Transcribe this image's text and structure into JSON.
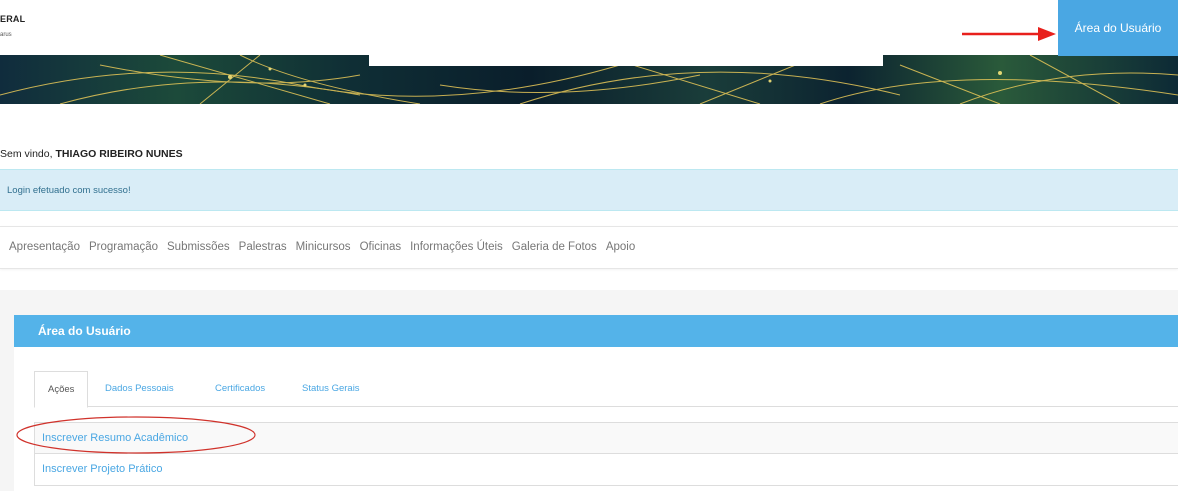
{
  "header": {
    "logo_line1": "ERAL",
    "logo_line2": "arus",
    "user_area_button": "Área do Usuário"
  },
  "welcome": {
    "prefix": "Sem vindo, ",
    "user_name": "THIAGO RIBEIRO NUNES"
  },
  "alert": {
    "message": "Login efetuado com sucesso!"
  },
  "nav": {
    "items": [
      "Apresentação",
      "Programação",
      "Submissões",
      "Palestras",
      "Minicursos",
      "Oficinas",
      "Informações Úteis",
      "Galeria de Fotos",
      "Apoio"
    ]
  },
  "panel": {
    "title": "Área do Usuário",
    "tabs": [
      "Ações",
      "Dados Pessoais",
      "Certificados",
      "Status Gerais"
    ],
    "active_tab": "Ações",
    "actions": [
      "Inscrever Resumo Acadêmico",
      "Inscrever Projeto Prático"
    ]
  },
  "annotations": {
    "arrow_color": "#e8201c",
    "ellipse_color": "#d0322b"
  },
  "colors": {
    "accent": "#4aa7e3",
    "panel_heading": "#54b3e9",
    "alert_bg": "#d9edf7"
  }
}
